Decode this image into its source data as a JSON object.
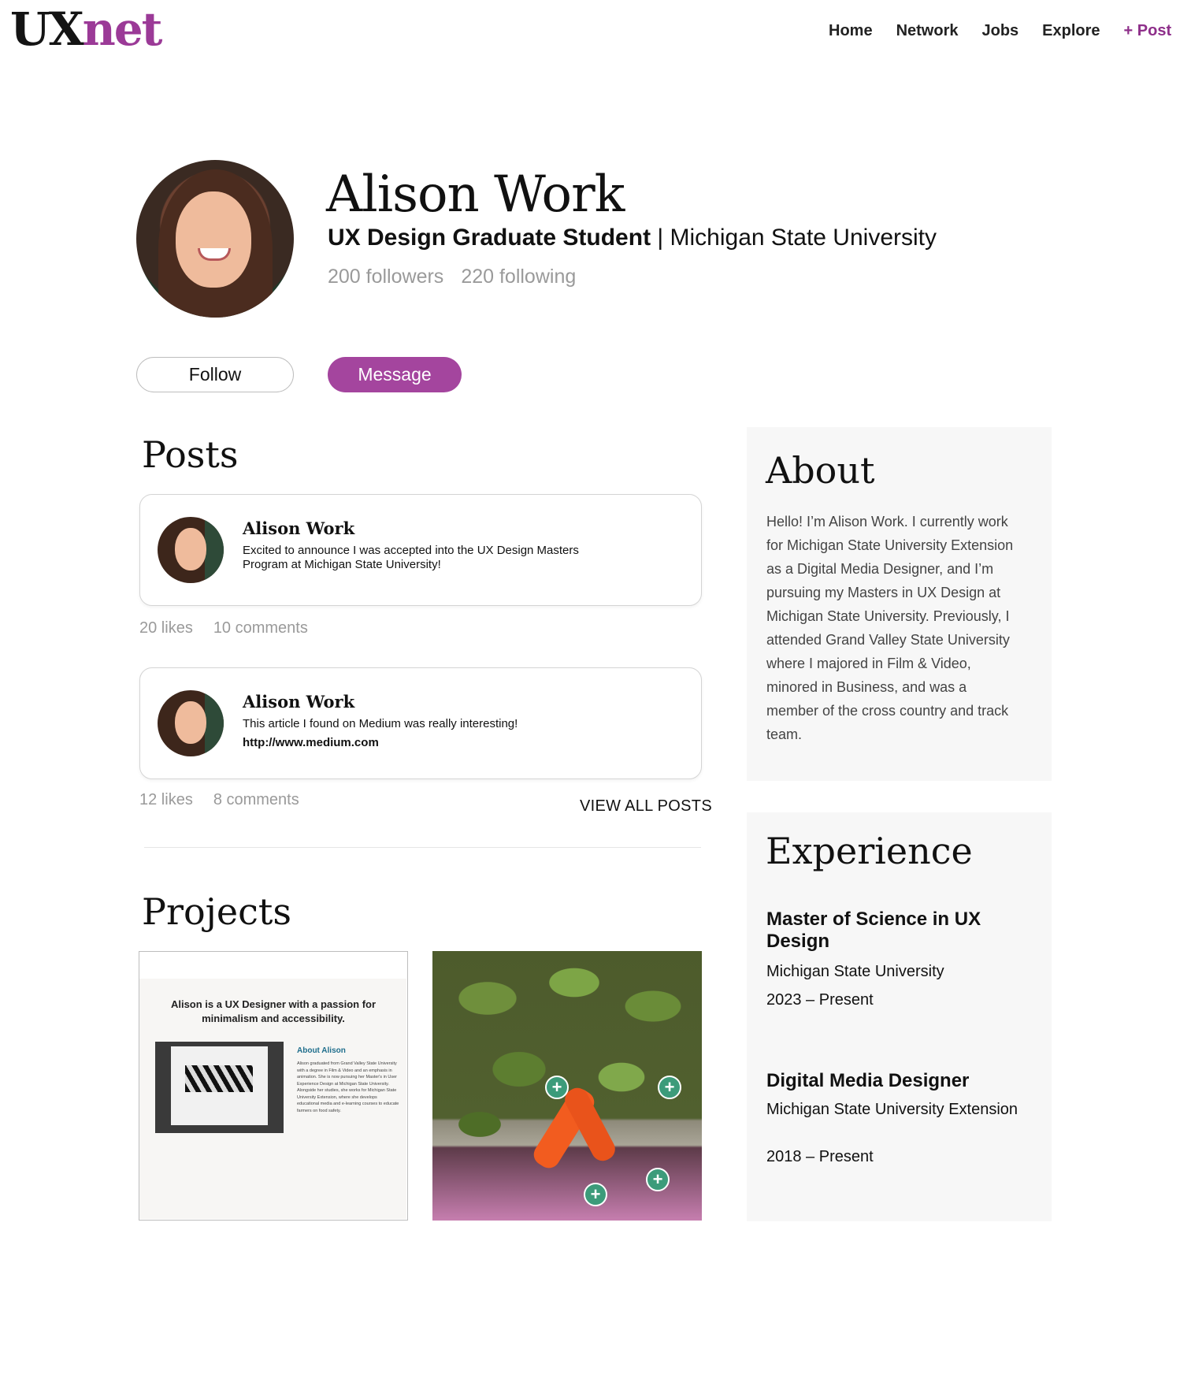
{
  "header": {
    "logo_ux": "UX",
    "logo_net": "net",
    "nav": [
      "Home",
      "Network",
      "Jobs",
      "Explore",
      "+ Post"
    ]
  },
  "profile": {
    "name": "Alison Work",
    "title_bold": "UX Design Graduate Student",
    "title_rest": " | Michigan State University",
    "followers": "200 followers",
    "following": "220 following",
    "follow_label": "Follow",
    "message_label": "Message"
  },
  "posts": {
    "title": "Posts",
    "items": [
      {
        "author": "Alison Work",
        "text": "Excited to announce I was accepted into the UX Design Masters Program at Michigan State University!",
        "link": "",
        "likes": "20 likes",
        "comments": "10 comments"
      },
      {
        "author": "Alison Work",
        "text": "This article I found on Medium was really interesting!",
        "link": "http://www.medium.com",
        "likes": "12 likes",
        "comments": "8 comments"
      }
    ],
    "view_all": "VIEW ALL POSTS"
  },
  "projects": {
    "title": "Projects",
    "p1_tagline": "Alison is a UX Designer with a passion for minimalism and accessibility.",
    "p1_about_heading": "About Alison",
    "p1_about_body": "Alison graduated from Grand Valley State University with a degree in Film & Video and an emphasis in animation. She is now pursuing her Master's in User Experience Design at Michigan State University. Alongside her studies, she works for Michigan State University Extension, where she develops educational media and e-learning courses to educate farmers on food safety.",
    "plus_symbol": "+"
  },
  "about": {
    "title": "About",
    "text": "Hello! I’m Alison Work. I currently work for Michigan State University Extension as a Digital Media Designer, and I’m pursuing my Masters in UX Design at Michigan State University. Previously, I attended Grand Valley State University where I majored in Film & Video, minored in Business, and was a member of the cross country and track team."
  },
  "experience": {
    "title": "Experience",
    "items": [
      {
        "role": "Master of Science in UX Design",
        "org": "Michigan State University",
        "dates": "2023 – Present"
      },
      {
        "role": "Digital Media Designer",
        "org": "Michigan State University Extension",
        "dates": "2018 – Present"
      }
    ]
  },
  "colors": {
    "brand_purple": "#9b3a97",
    "message_button": "#a4459e",
    "hotspot_green": "#3c9b7a"
  }
}
